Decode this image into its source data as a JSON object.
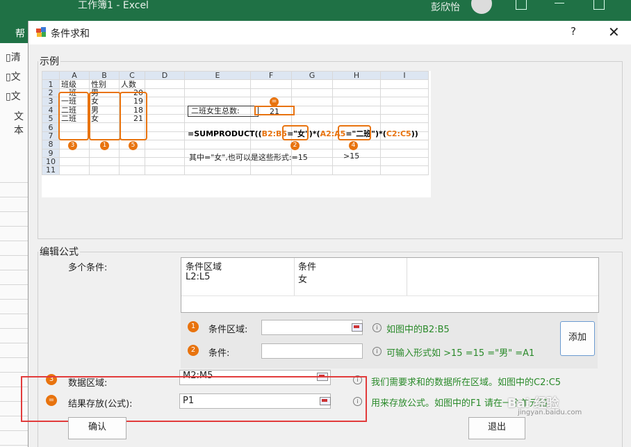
{
  "excel": {
    "title": "工作簿1  -  Excel",
    "user": "彭欣怡",
    "ribbon_tab": "帮",
    "side_items": [
      "清",
      "文",
      "文"
    ],
    "side_text": "文本"
  },
  "dialog": {
    "title": "条件求和",
    "help": "?",
    "close": "✕",
    "example_legend": "示例",
    "edit_legend": "编辑公式",
    "multi_cond_label": "多个条件:",
    "list": {
      "col1": "条件区域",
      "col2": "条件",
      "row1_col1": "L2:L5",
      "row1_col2": "女"
    },
    "cond_range_label": "条件区域:",
    "cond_range_value": "",
    "cond_range_tip": "如图中的B2:B5",
    "cond_label": "条件:",
    "cond_value": "",
    "cond_tip": "可输入形式如  >15   =15   =\"男\"   =A1",
    "add_button": "添加",
    "data_range_label": "数据区域:",
    "data_range_value": "M2:M5",
    "data_range_tip": "我们需要求和的数据所在区域。如图中的C2:C5",
    "result_label": "结果存放(公式):",
    "result_value": "P1",
    "result_tip": "用来存放公式。如图中的F1 请在一个单元格",
    "ok_button": "确认",
    "exit_button": "退出",
    "step_marks": [
      "1",
      "2",
      "3",
      "="
    ]
  },
  "example": {
    "col_headers": [
      "A",
      "B",
      "C",
      "D",
      "E",
      "F",
      "G",
      "H",
      "I"
    ],
    "rows": [
      [
        "1",
        "班级",
        "性别",
        "人数"
      ],
      [
        "2",
        "一班",
        "男",
        "20"
      ],
      [
        "3",
        "一班",
        "女",
        "19"
      ],
      [
        "4",
        "二班",
        "男",
        "18"
      ],
      [
        "5",
        "二班",
        "女",
        "21"
      ],
      [
        "6"
      ],
      [
        "7"
      ],
      [
        "8"
      ],
      [
        "9"
      ],
      [
        "10"
      ],
      [
        "11"
      ]
    ],
    "total_label": "二班女生总数:",
    "total_value": "21",
    "formula_parts": [
      "=SUMPRODUCT((",
      "B2:B5",
      "=\"女\")*(",
      "A2:A5",
      "=\"二班\")*(",
      "C2:C5",
      "))"
    ],
    "note": "其中=\"女\",也可以是这些形式:=15",
    "note2": ">15",
    "markers": [
      "3",
      "1",
      "5",
      "2",
      "4",
      "="
    ]
  },
  "watermark": "Bai 经验",
  "watermark_url": "jingyan.baidu.com",
  "colors": {
    "excel_green": "#1f7145",
    "orange": "#e8730e",
    "tip_green": "#2a8a2a",
    "red_box": "#e23b3b"
  }
}
